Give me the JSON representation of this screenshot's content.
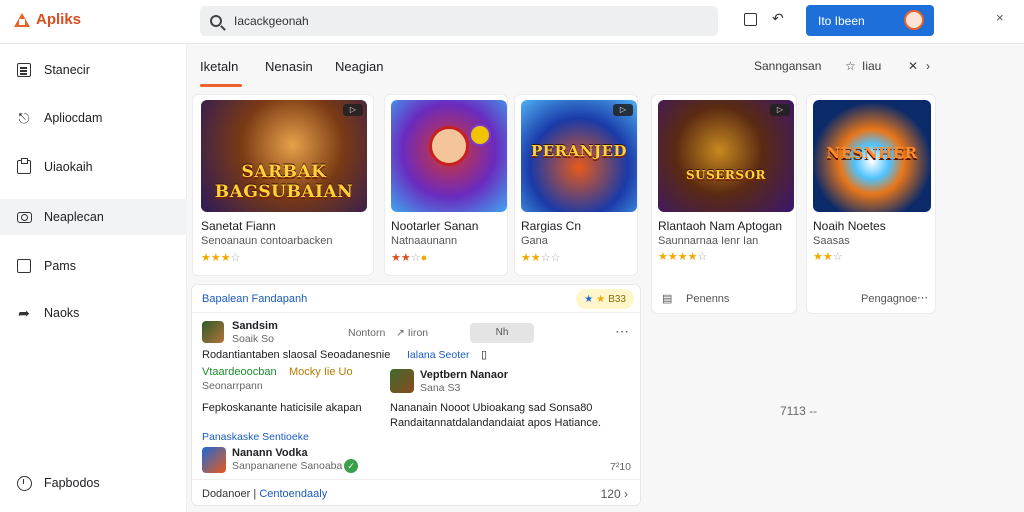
{
  "app": {
    "name": "Apliks"
  },
  "search": {
    "value": "Iacackgeonah"
  },
  "header": {
    "install_label": "Ito Ibeen",
    "close": "×",
    "refresh": "↶"
  },
  "sidebar": {
    "items": [
      {
        "label": "Stanecir",
        "icon": "list-icon"
      },
      {
        "label": "Apliocdam",
        "icon": "tag-icon"
      },
      {
        "label": "Uiaokaih",
        "icon": "clipboard-icon"
      },
      {
        "label": "Neaplecan",
        "icon": "camera-icon"
      },
      {
        "label": "Pams",
        "icon": "square-icon"
      },
      {
        "label": "Naoks",
        "icon": "share-icon"
      }
    ],
    "footer": {
      "label": "Fapbodos",
      "icon": "clock-icon"
    }
  },
  "tabs": [
    {
      "label": "Iketaln",
      "active": true
    },
    {
      "label": "Nenasin",
      "active": false
    },
    {
      "label": "Neagian",
      "active": false
    }
  ],
  "tab_right": {
    "sort": "Sanngansan",
    "fav": "Iiau",
    "more": "›"
  },
  "apps": [
    {
      "thumb_text": "SARBAK BAGSUBAIAN",
      "title": "Sanetat Fiann",
      "subtitle": "Senoanaun contoarbacken",
      "stars": "★★★☆",
      "colors": [
        "#7a3a14",
        "#e7a14a",
        "#2b1a5a"
      ]
    },
    {
      "thumb_text": "",
      "title": "Nootarler Sanan",
      "subtitle": "Natnaaunann",
      "stars": "★★☆",
      "colors": [
        "#6a2bbf",
        "#d8362b",
        "#3fa7f0"
      ]
    },
    {
      "thumb_text": "PERANJED",
      "title": "Rargias Cn",
      "subtitle": "Gana",
      "stars": "★★☆☆",
      "colors": [
        "#1a3aa8",
        "#e85a1a",
        "#4fb2f5"
      ]
    },
    {
      "thumb_text": "SUSERSOR",
      "title": "Rlantaoh Nam Aptogan",
      "subtitle": "Saunnarnaa Ienr Ian",
      "stars": "★★★★☆",
      "footer": "Penenns",
      "colors": [
        "#5a2a12",
        "#c7891f",
        "#3a1670"
      ]
    },
    {
      "thumb_text": "NESNHER",
      "title": "Noaih Noetes",
      "subtitle": "Saasas",
      "stars": "★★☆",
      "footer": "Pengagnoe",
      "colors": [
        "#0a2a6a",
        "#e8761a",
        "#4fc3ff"
      ]
    }
  ],
  "feed": {
    "title": "Bapalean Fandapanh",
    "rating": "B33",
    "post": {
      "author": "Sandsim",
      "handle": "Soaik So",
      "pill": "Nh",
      "meta": "Nontorn",
      "meta2": "↗ Iiron",
      "body": "Rodantiantaben slaosal Seoadanesnie",
      "link": "Ialana Seoter",
      "link_tail": "▯",
      "green": "Vtaardeoocban",
      "green_tail": "Mocky Iie Uo",
      "grey": "Seonarrpann",
      "line2": "Fepkoskanante haticisile akapan",
      "reply_author": "Veptbern Nanaor",
      "reply_handle": "Sana S3",
      "reply_body_1": "Nananain Nooot Ubioakang sad Sonsa80",
      "reply_body_2": "Randaitannatdalandandaiat apos Hatiance.",
      "sub_link": "Panaskaske Sentioeke",
      "sub_author": "Nanann Vodka",
      "sub_handle": "Sanpananene Sanoaba",
      "sub_count": "7²10"
    },
    "footer_left": "Dodanoer",
    "footer_link": "Centoendaaly",
    "footer_right": "120"
  },
  "empty_count": "7113 --"
}
